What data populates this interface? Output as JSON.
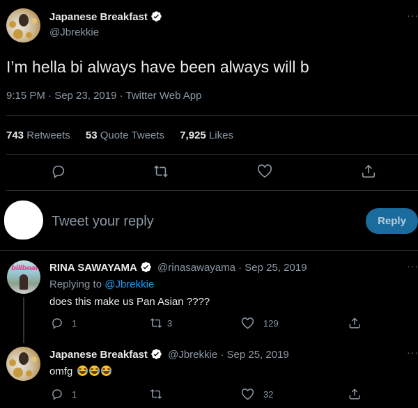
{
  "main_tweet": {
    "author_name": "Japanese Breakfast",
    "handle": "@Jbrekkie",
    "text": "I’m hella bi always have been always will b",
    "meta": "9:15 PM · Sep 23, 2019 · Twitter Web App",
    "stats": {
      "retweets_count": "743",
      "retweets_label": "Retweets",
      "quotes_count": "53",
      "quotes_label": "Quote Tweets",
      "likes_count": "7,925",
      "likes_label": "Likes"
    }
  },
  "composer": {
    "placeholder": "Tweet your reply",
    "button_label": "Reply"
  },
  "replies": [
    {
      "author_name": "RINA SAWAYAMA",
      "handle_date": "@rinasawayama · Sep 25, 2019",
      "replying_prefix": "Replying to",
      "replying_to": "@Jbrekkie",
      "text": "does this make us Pan Asian ????",
      "reply_count": "1",
      "retweet_count": "3",
      "like_count": "129",
      "avatar_logo_text": "billboard"
    },
    {
      "author_name": "Japanese Breakfast",
      "handle_date": "@Jbrekkie · Sep 25, 2019",
      "text": "omfg",
      "emojis": [
        "face-with-tears-of-joy",
        "face-with-tears-of-joy",
        "face-with-tears-of-joy"
      ],
      "reply_count": "1",
      "like_count": "32"
    }
  ],
  "colors": {
    "background": "#000000",
    "accent": "#1d9bf0",
    "muted_text": "#8b98a5",
    "reply_button": "#1a6b9e"
  }
}
